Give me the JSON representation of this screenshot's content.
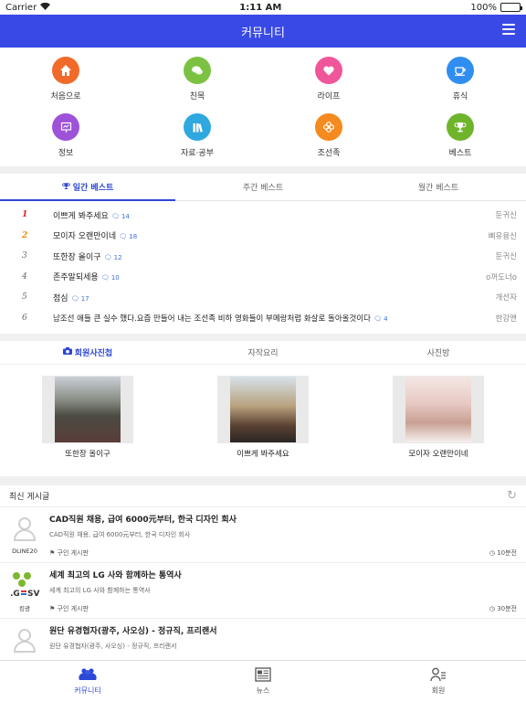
{
  "status_bar": {
    "carrier": "Carrier",
    "time": "1:11 AM",
    "battery": "100%"
  },
  "header": {
    "title": "커뮤니티"
  },
  "categories": [
    {
      "label": "처음으로",
      "color": "#f26a2a",
      "icon": "home-icon"
    },
    {
      "label": "친목",
      "color": "#7cc242",
      "icon": "chat-bubbles-icon"
    },
    {
      "label": "라이프",
      "color": "#f0569a",
      "icon": "heart-icon"
    },
    {
      "label": "휴식",
      "color": "#2f8ef0",
      "icon": "coffee-cup-icon"
    },
    {
      "label": "정보",
      "color": "#9d52d8",
      "icon": "presentation-board-icon"
    },
    {
      "label": "자료·공부",
      "color": "#2fa8e0",
      "icon": "books-icon"
    },
    {
      "label": "조선족",
      "color": "#f58a1f",
      "icon": "flower-icon"
    },
    {
      "label": "베스트",
      "color": "#6fb52c",
      "icon": "trophy-icon"
    }
  ],
  "best_tabs": [
    "일간 베스트",
    "주간 베스트",
    "월간 베스트"
  ],
  "best_posts": [
    {
      "rank": "1",
      "title": "이쁘게 봐주세요",
      "comments": "14",
      "author": "둔귀신"
    },
    {
      "rank": "2",
      "title": "모이자 오랜만이네",
      "comments": "18",
      "author": "삐유융신"
    },
    {
      "rank": "3",
      "title": "또한장 올이구",
      "comments": "12",
      "author": "둔귀신"
    },
    {
      "rank": "4",
      "title": "존주말되세용",
      "comments": "10",
      "author": "o꺼도너o"
    },
    {
      "rank": "5",
      "title": "점심",
      "comments": "17",
      "author": "개선자"
    },
    {
      "rank": "6",
      "title": "남조선 애들 큰 실수 했다.요즘 만들어 내는 조선족 비하 영화들이 부메랑처럼 화살로 돌아올것이다",
      "comments": "4",
      "author": "한강맨"
    }
  ],
  "photo_tabs": [
    "회원사진첩",
    "자작요리",
    "사진방"
  ],
  "photos": [
    {
      "caption": "또한장 올이구"
    },
    {
      "caption": "이쁘게 봐주세요"
    },
    {
      "caption": "모이자 오랜만이네"
    }
  ],
  "recent": {
    "heading": "최신 게시글",
    "posts": [
      {
        "author": "DLINE20",
        "title": "CAD직원 채용, 급여 6000元부터, 한국 디자인 회사",
        "subtitle": "CAD직원 채용, 급여 6000元부터, 한국 디자인 회사",
        "board": "구인 게시판",
        "time": "10분전"
      },
      {
        "author": "킹광",
        "title": "세계 최고의 LG 사와 함께하는 통역사",
        "subtitle": "세계 최고의 LG 사와 함께하는 통역사",
        "board": "구인 게시판",
        "time": "30분전"
      },
      {
        "author": "",
        "title": "원단 유경협자(광주, 사오싱) - 정규직, 프리랜서",
        "subtitle": "원단 유경협자(광주, 사오싱) - 정규직, 프리랜서",
        "board": "",
        "time": ""
      }
    ]
  },
  "tabbar": [
    "커뮤니티",
    "뉴스",
    "회원"
  ]
}
